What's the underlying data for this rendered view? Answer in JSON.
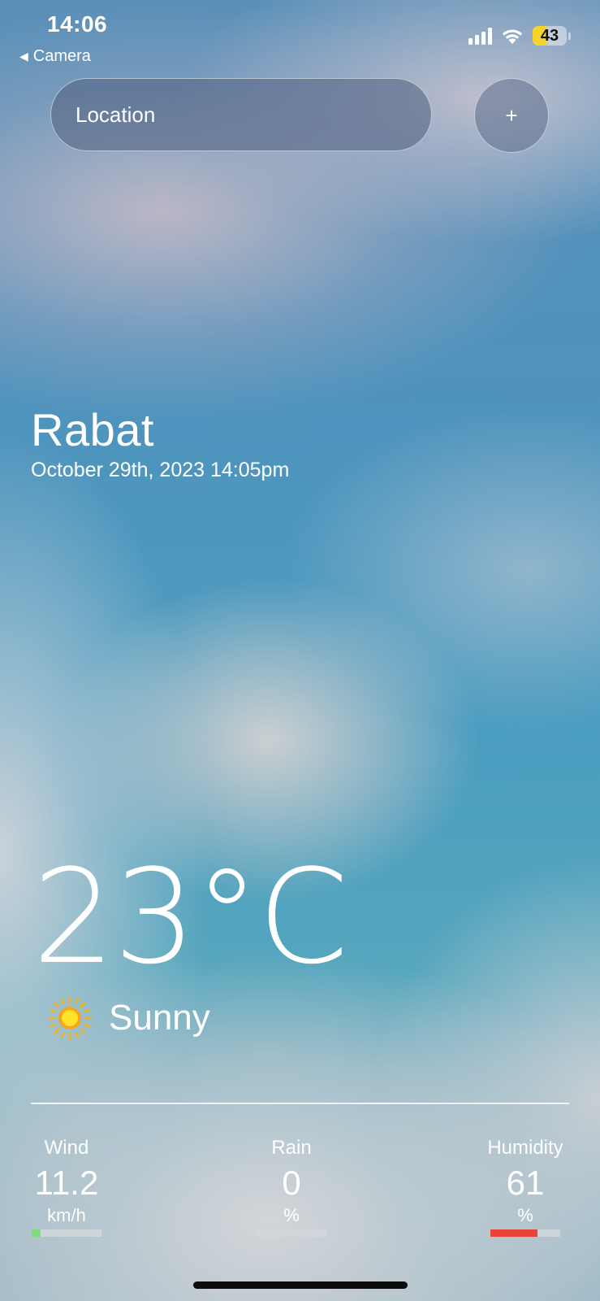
{
  "status_bar": {
    "time": "14:06",
    "back_app": "Camera",
    "battery_level": "43",
    "battery_fraction": 0.43,
    "battery_color": "#f6d32d"
  },
  "search": {
    "placeholder": "Location",
    "add_label": "+"
  },
  "location": {
    "city": "Rabat",
    "datetime": "October 29th, 2023 14:05pm"
  },
  "current": {
    "temperature": "23°C",
    "condition": "Sunny",
    "condition_icon": "sun-icon"
  },
  "stats": {
    "wind": {
      "label": "Wind",
      "value": "11.2",
      "unit": "km/h",
      "level": 0.13,
      "bar_color": "#7be07a"
    },
    "rain": {
      "label": "Rain",
      "value": "0",
      "unit": "%",
      "level": 0.0,
      "bar_color": "#7be07a"
    },
    "humidity": {
      "label": "Humidity",
      "value": "61",
      "unit": "%",
      "level": 0.68,
      "bar_color": "#e8443a"
    }
  }
}
